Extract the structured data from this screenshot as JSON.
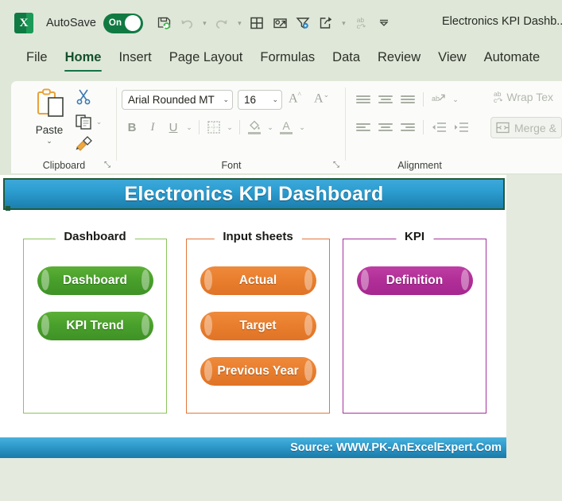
{
  "titlebar": {
    "app_icon": "excel-logo",
    "app_icon_letter": "X",
    "autosave_label": "AutoSave",
    "autosave_state": "On",
    "document_title": "Electronics KPI Dashb...",
    "quick_access": [
      {
        "name": "save-icon",
        "glyph": "save"
      },
      {
        "name": "undo-icon",
        "glyph": "undo"
      },
      {
        "name": "undo-dropdown-icon",
        "glyph": "chevron-down"
      },
      {
        "name": "redo-icon",
        "glyph": "redo"
      },
      {
        "name": "redo-dropdown-icon",
        "glyph": "chevron-down"
      },
      {
        "name": "table-icon",
        "glyph": "grid"
      },
      {
        "name": "attach-send-icon",
        "glyph": "attach"
      },
      {
        "name": "filter-icon",
        "glyph": "funnel"
      },
      {
        "name": "share-icon",
        "glyph": "share"
      },
      {
        "name": "share-dropdown-icon",
        "glyph": "chevron-down"
      },
      {
        "name": "spelling-icon",
        "glyph": "abc"
      },
      {
        "name": "customize-quick-access-toolbar-icon",
        "glyph": "chevron-down-bar"
      }
    ]
  },
  "ribbon_tabs": [
    {
      "label": "File",
      "active": false
    },
    {
      "label": "Home",
      "active": true
    },
    {
      "label": "Insert",
      "active": false
    },
    {
      "label": "Page Layout",
      "active": false
    },
    {
      "label": "Formulas",
      "active": false
    },
    {
      "label": "Data",
      "active": false
    },
    {
      "label": "Review",
      "active": false
    },
    {
      "label": "View",
      "active": false
    },
    {
      "label": "Automate",
      "active": false
    }
  ],
  "ribbon": {
    "clipboard": {
      "group_label": "Clipboard",
      "paste_label": "Paste",
      "paste_dropdown": "⌄",
      "cut_label": "Cut",
      "copy_label": "Copy",
      "copy_dropdown": "⌄",
      "format_painter_label": "Format Painter",
      "dialog_launcher": "⤡"
    },
    "font": {
      "group_label": "Font",
      "font_name": "Arial Rounded MT",
      "font_name_dropdown": "⌄",
      "font_size": "16",
      "font_size_dropdown": "⌄",
      "grow_font": "A",
      "shrink_font": "A",
      "bold": "B",
      "italic": "I",
      "underline": "U",
      "underline_dropdown": "⌄",
      "borders_dropdown": "⌄",
      "fill_color_dropdown": "⌄",
      "font_color": "A",
      "font_color_dropdown": "⌄",
      "dialog_launcher": "⤡"
    },
    "alignment": {
      "group_label": "Alignment",
      "wrap_text_label": "Wrap Tex",
      "merge_label": "Merge &",
      "orientation_dropdown": "⌄"
    }
  },
  "sheet": {
    "banner_title": "Electronics KPI Dashboard",
    "groups": [
      {
        "title": "Dashboard",
        "border_color": "#8cc45e",
        "pill_class": "pill-green",
        "buttons": [
          {
            "label": "Dashboard"
          },
          {
            "label": "KPI Trend"
          }
        ]
      },
      {
        "title": "Input sheets",
        "border_color": "#e2763a",
        "pill_class": "pill-orange",
        "buttons": [
          {
            "label": "Actual"
          },
          {
            "label": "Target"
          },
          {
            "label": "Previous Year"
          }
        ]
      },
      {
        "title": "KPI",
        "border_color": "#a5319b",
        "pill_class": "pill-purple",
        "buttons": [
          {
            "label": "Definition"
          }
        ]
      }
    ],
    "footer_text": "Source: WWW.PK-AnExcelExpert.Com"
  },
  "colors": {
    "excel_green": "#0f7a42",
    "tab_accent": "#157347",
    "banner_blue_top": "#3da8d8",
    "banner_blue_bottom": "#1b7fae",
    "green_pill": "#49a02b",
    "orange_pill": "#e97f2e",
    "purple_pill": "#b12f97",
    "sheet_background": "#ffffff",
    "window_background": "#e4eade"
  }
}
